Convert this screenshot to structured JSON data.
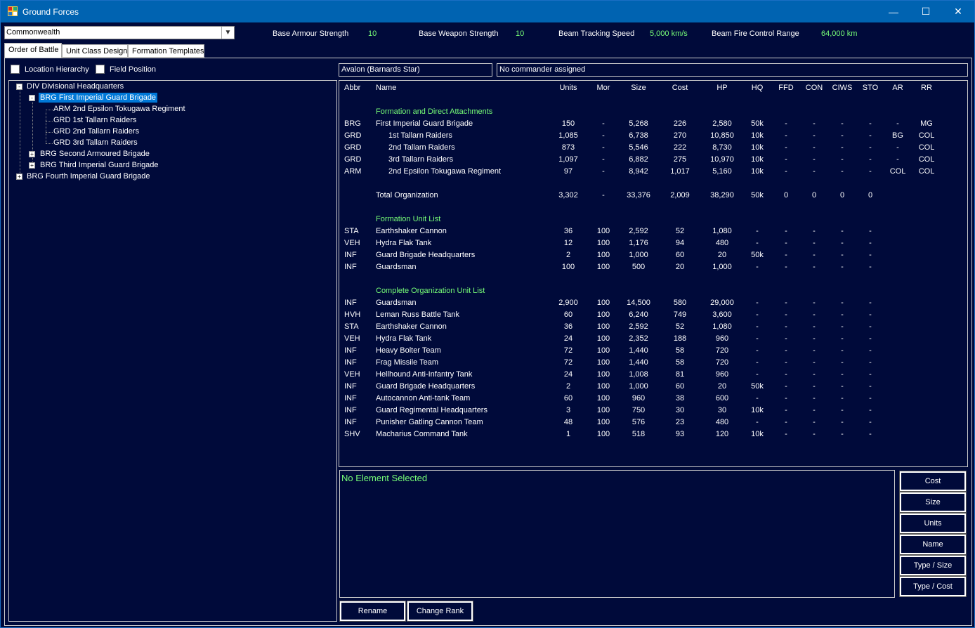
{
  "window": {
    "title": "Ground Forces",
    "minimize": "—",
    "maximize": "☐",
    "close": "✕"
  },
  "race_select": {
    "value": "Commonwealth"
  },
  "stats": [
    {
      "label": "Base Armour Strength",
      "value": "10"
    },
    {
      "label": "Base Weapon Strength",
      "value": "10"
    },
    {
      "label": "Beam Tracking Speed",
      "value": "5,000 km/s"
    },
    {
      "label": "Beam Fire Control Range",
      "value": "64,000 km"
    }
  ],
  "tabs": [
    "Order of Battle",
    "Unit Class Design",
    "Formation Templates"
  ],
  "checkboxes": [
    "Location Hierarchy",
    "Field Position"
  ],
  "tree": [
    {
      "label": "DIV Divisional Headquarters",
      "level": 0,
      "expander": "-"
    },
    {
      "label": "BRG First Imperial Guard Brigade",
      "level": 1,
      "expander": "-",
      "selected": true
    },
    {
      "label": "ARM 2nd Epsilon Tokugawa Regiment",
      "level": 2,
      "expander": ""
    },
    {
      "label": "GRD 1st Tallarn Raiders",
      "level": 2,
      "expander": ""
    },
    {
      "label": "GRD 2nd Tallarn Raiders",
      "level": 2,
      "expander": ""
    },
    {
      "label": "GRD 3rd Tallarn Raiders",
      "level": 2,
      "expander": ""
    },
    {
      "label": "BRG Second Armoured Brigade",
      "level": 1,
      "expander": "+"
    },
    {
      "label": "BRG Third Imperial Guard Brigade",
      "level": 1,
      "expander": "+"
    },
    {
      "label": "BRG Fourth Imperial Guard Brigade",
      "level": 0,
      "expander": "+"
    }
  ],
  "location": "Avalon  (Barnards Star)",
  "commander": "No commander assigned",
  "table": {
    "headers": [
      "Abbr",
      "Name",
      "Units",
      "Mor",
      "Size",
      "Cost",
      "HP",
      "HQ",
      "FFD",
      "CON",
      "CIWS",
      "STO",
      "AR",
      "RR"
    ],
    "rows": [
      {
        "section": "Formation and Direct Attachments"
      },
      {
        "cells": [
          "BRG",
          "First Imperial Guard Brigade",
          "150",
          "-",
          "5,268",
          "226",
          "2,580",
          "50k",
          "-",
          "-",
          "-",
          "-",
          "-",
          "MG"
        ]
      },
      {
        "indent": true,
        "cells": [
          "GRD",
          "1st Tallarn Raiders",
          "1,085",
          "-",
          "6,738",
          "270",
          "10,850",
          "10k",
          "-",
          "-",
          "-",
          "-",
          "BG",
          "COL"
        ]
      },
      {
        "indent": true,
        "cells": [
          "GRD",
          "2nd Tallarn Raiders",
          "873",
          "-",
          "5,546",
          "222",
          "8,730",
          "10k",
          "-",
          "-",
          "-",
          "-",
          "-",
          "COL"
        ]
      },
      {
        "indent": true,
        "cells": [
          "GRD",
          "3rd Tallarn Raiders",
          "1,097",
          "-",
          "6,882",
          "275",
          "10,970",
          "10k",
          "-",
          "-",
          "-",
          "-",
          "-",
          "COL"
        ]
      },
      {
        "indent": true,
        "cells": [
          "ARM",
          "2nd Epsilon Tokugawa Regiment",
          "97",
          "-",
          "8,942",
          "1,017",
          "5,160",
          "10k",
          "-",
          "-",
          "-",
          "-",
          "COL",
          "COL"
        ]
      },
      {
        "blank": true
      },
      {
        "cells": [
          "",
          "Total Organization",
          "3,302",
          "-",
          "33,376",
          "2,009",
          "38,290",
          "50k",
          "0",
          "0",
          "0",
          "0",
          "",
          ""
        ]
      },
      {
        "blank": true
      },
      {
        "section": "Formation Unit List"
      },
      {
        "cells": [
          "STA",
          "Earthshaker Cannon",
          "36",
          "100",
          "2,592",
          "52",
          "1,080",
          "-",
          "-",
          "-",
          "-",
          "-",
          "",
          ""
        ]
      },
      {
        "cells": [
          "VEH",
          "Hydra Flak Tank",
          "12",
          "100",
          "1,176",
          "94",
          "480",
          "-",
          "-",
          "-",
          "-",
          "-",
          "",
          ""
        ]
      },
      {
        "cells": [
          "INF",
          "Guard Brigade Headquarters",
          "2",
          "100",
          "1,000",
          "60",
          "20",
          "50k",
          "-",
          "-",
          "-",
          "-",
          "",
          ""
        ]
      },
      {
        "cells": [
          "INF",
          "Guardsman",
          "100",
          "100",
          "500",
          "20",
          "1,000",
          "-",
          "-",
          "-",
          "-",
          "-",
          "",
          ""
        ]
      },
      {
        "blank": true
      },
      {
        "section": "Complete Organization Unit List"
      },
      {
        "cells": [
          "INF",
          "Guardsman",
          "2,900",
          "100",
          "14,500",
          "580",
          "29,000",
          "-",
          "-",
          "-",
          "-",
          "-",
          "",
          ""
        ]
      },
      {
        "cells": [
          "HVH",
          "Leman Russ Battle Tank",
          "60",
          "100",
          "6,240",
          "749",
          "3,600",
          "-",
          "-",
          "-",
          "-",
          "-",
          "",
          ""
        ]
      },
      {
        "cells": [
          "STA",
          "Earthshaker Cannon",
          "36",
          "100",
          "2,592",
          "52",
          "1,080",
          "-",
          "-",
          "-",
          "-",
          "-",
          "",
          ""
        ]
      },
      {
        "cells": [
          "VEH",
          "Hydra Flak Tank",
          "24",
          "100",
          "2,352",
          "188",
          "960",
          "-",
          "-",
          "-",
          "-",
          "-",
          "",
          ""
        ]
      },
      {
        "cells": [
          "INF",
          "Heavy Bolter Team",
          "72",
          "100",
          "1,440",
          "58",
          "720",
          "-",
          "-",
          "-",
          "-",
          "-",
          "",
          ""
        ]
      },
      {
        "cells": [
          "INF",
          "Frag Missile Team",
          "72",
          "100",
          "1,440",
          "58",
          "720",
          "-",
          "-",
          "-",
          "-",
          "-",
          "",
          ""
        ]
      },
      {
        "cells": [
          "VEH",
          "Hellhound Anti-Infantry Tank",
          "24",
          "100",
          "1,008",
          "81",
          "960",
          "-",
          "-",
          "-",
          "-",
          "-",
          "",
          ""
        ]
      },
      {
        "cells": [
          "INF",
          "Guard Brigade Headquarters",
          "2",
          "100",
          "1,000",
          "60",
          "20",
          "50k",
          "-",
          "-",
          "-",
          "-",
          "",
          ""
        ]
      },
      {
        "cells": [
          "INF",
          "Autocannon Anti-tank Team",
          "60",
          "100",
          "960",
          "38",
          "600",
          "-",
          "-",
          "-",
          "-",
          "-",
          "",
          ""
        ]
      },
      {
        "cells": [
          "INF",
          "Guard Regimental Headquarters",
          "3",
          "100",
          "750",
          "30",
          "30",
          "10k",
          "-",
          "-",
          "-",
          "-",
          "",
          ""
        ]
      },
      {
        "cells": [
          "INF",
          "Punisher Gatling Cannon Team",
          "48",
          "100",
          "576",
          "23",
          "480",
          "-",
          "-",
          "-",
          "-",
          "-",
          "",
          ""
        ]
      },
      {
        "cells": [
          "SHV",
          "Macharius Command Tank",
          "1",
          "100",
          "518",
          "93",
          "120",
          "10k",
          "-",
          "-",
          "-",
          "-",
          "",
          ""
        ]
      }
    ]
  },
  "detail_text": "No Element Selected",
  "sort_buttons": [
    "Cost",
    "Size",
    "Units",
    "Name",
    "Type / Size",
    "Type / Cost"
  ],
  "bottom_buttons": [
    "Rename",
    "Change Rank"
  ],
  "colors": {
    "background": "#000a3a",
    "titlebar": "#0063b1",
    "section_text": "#77ff77",
    "selection": "#0078d7"
  }
}
